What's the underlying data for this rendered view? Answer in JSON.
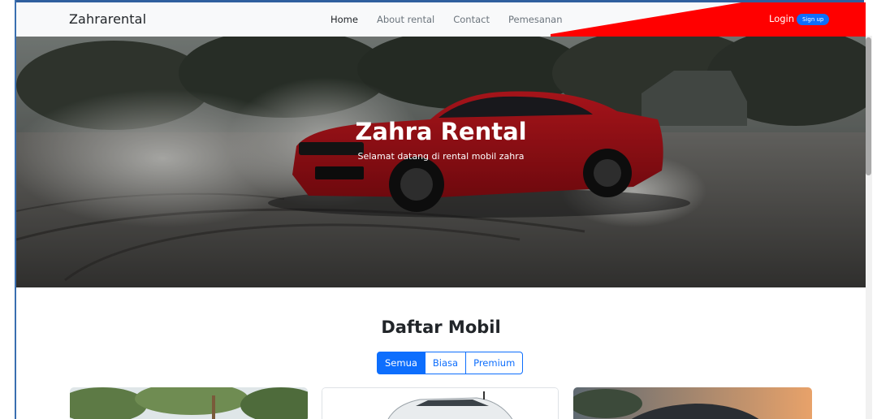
{
  "navbar": {
    "brand": "Zahrarental",
    "links": [
      {
        "label": "Home",
        "active": true
      },
      {
        "label": "About rental",
        "active": false
      },
      {
        "label": "Contact",
        "active": false
      },
      {
        "label": "Pemesanan",
        "active": false
      }
    ],
    "login_label": "Login",
    "signup_label": "Sign up"
  },
  "hero": {
    "title": "Zahra Rental",
    "subtitle": "Selamat datang di rental mobil zahra"
  },
  "catalog": {
    "title": "Daftar Mobil",
    "filters": [
      {
        "label": "Semua",
        "active": true
      },
      {
        "label": "Biasa",
        "active": false
      },
      {
        "label": "Premium",
        "active": false
      }
    ]
  },
  "colors": {
    "accent": "#0d6efd",
    "navbar_wedge": "#ff0000",
    "car_red": "#c8121a"
  }
}
